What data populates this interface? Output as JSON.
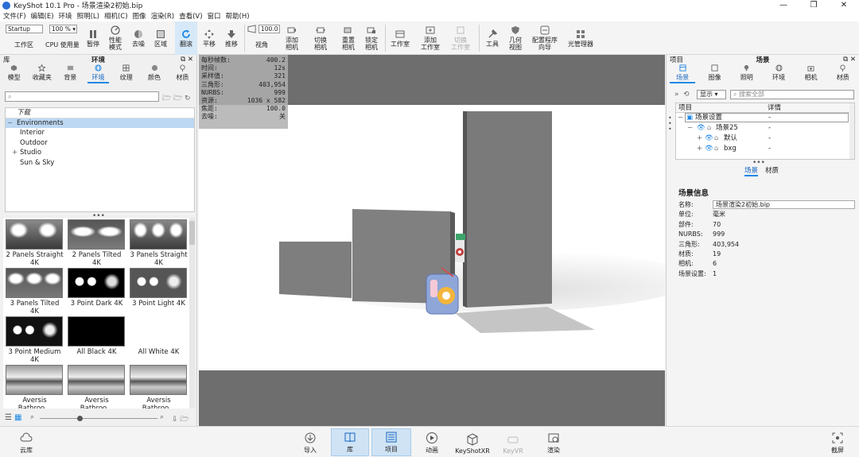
{
  "app": {
    "title": "KeyShot 10.1 Pro - 场景渲染2初始.bip",
    "window_controls": [
      "—",
      "❐",
      "✕"
    ]
  },
  "menu": [
    "文件(F)",
    "编辑(E)",
    "环境",
    "照明(L)",
    "相机(C)",
    "图像",
    "渲染(R)",
    "查看(V)",
    "窗口",
    "帮助(H)"
  ],
  "toolbar": {
    "workspace_select": "Startup",
    "workspace_label": "工作区",
    "cpu_select": "100 % ▾",
    "cpu_label": "CPU 使用量",
    "pause": "暂停",
    "perf_mode": "性能\n模式",
    "denoise": "去噪",
    "region": "区域",
    "flip": "翻滚",
    "pan": "平移",
    "push": "推移",
    "fov_value": "100.0",
    "fov_label": "视角",
    "add_camera": "添加\n相机",
    "switch_camera": "切换\n相机",
    "reset_camera": "重置\n相机",
    "lock_camera": "锁定\n相机",
    "studio": "工作室",
    "add_studio": "添加\n工作室",
    "switch_studio": "切换\n工作室",
    "tools": "工具",
    "geometry_view": "几何\n视图",
    "config_wizard": "配置程序\n向导",
    "light_manager": "光管理器"
  },
  "library": {
    "panel_left": "库",
    "title": "环境",
    "tabs": [
      "模型",
      "收藏夹",
      "背景",
      "环境",
      "纹理",
      "颜色",
      "材质"
    ],
    "active_tab": "环境",
    "search_placeholder": "",
    "tree": {
      "header": "下载",
      "root": "Environments",
      "children": [
        "Interior",
        "Outdoor",
        "Studio",
        "Sun & Sky"
      ]
    },
    "thumbnails": [
      "2 Panels Straight 4K",
      "2 Panels Tilted 4K",
      "3 Panels Straight 4K",
      "3 Panels Tilted 4K",
      "3 Point Dark 4K",
      "3 Point Light 4K",
      "3 Point Medium 4K",
      "All Black 4K",
      "All White 4K",
      "Aversis Bathroo...",
      "Aversis Bathroo...",
      "Aversis Bathroo..."
    ]
  },
  "stats": [
    {
      "label": "每秒帧数:",
      "value": "400.2"
    },
    {
      "label": "时间:",
      "value": "12s"
    },
    {
      "label": "采样值:",
      "value": "321"
    },
    {
      "label": "三角形:",
      "value": "403,954"
    },
    {
      "label": "NURBS:",
      "value": "999"
    },
    {
      "label": "资源:",
      "value": "1036 x 582"
    },
    {
      "label": "焦距:",
      "value": "100.0"
    },
    {
      "label": "去噪:",
      "value": "关"
    }
  ],
  "project": {
    "panel_left": "项目",
    "title": "场景",
    "tabs": [
      "场景",
      "图像",
      "照明",
      "环境",
      "相机",
      "材质"
    ],
    "active_tab": "场景",
    "show_select": "显示",
    "search_placeholder": "搜索全部",
    "tree_columns": [
      "项目",
      "详情"
    ],
    "tree": [
      {
        "label": "场景设置",
        "detail": "-"
      },
      {
        "label": "场景25",
        "detail": "-"
      },
      {
        "label": "默认",
        "detail": "-"
      },
      {
        "label": "bxg",
        "detail": "-"
      }
    ],
    "subtabs": [
      "场景",
      "材质"
    ],
    "info_title": "场景信息",
    "info": [
      {
        "k": "名称:",
        "v": "场景渲染2初始.bip"
      },
      {
        "k": "单位:",
        "v": "毫米"
      },
      {
        "k": "部件:",
        "v": "70"
      },
      {
        "k": "NURBS:",
        "v": "999"
      },
      {
        "k": "三角形:",
        "v": "403,954"
      },
      {
        "k": "材质:",
        "v": "19"
      },
      {
        "k": "相机:",
        "v": "6"
      },
      {
        "k": "场景设置:",
        "v": "1"
      }
    ]
  },
  "bottom": {
    "cloud": "云库",
    "items": [
      "导入",
      "库",
      "项目",
      "动画",
      "KeyShotXR",
      "KeyVR",
      "渲染"
    ],
    "active": [
      "库",
      "项目"
    ],
    "screenshot": "截屏"
  },
  "colors": {
    "accent": "#1e88e5",
    "active_bg": "#d7e9f8"
  }
}
